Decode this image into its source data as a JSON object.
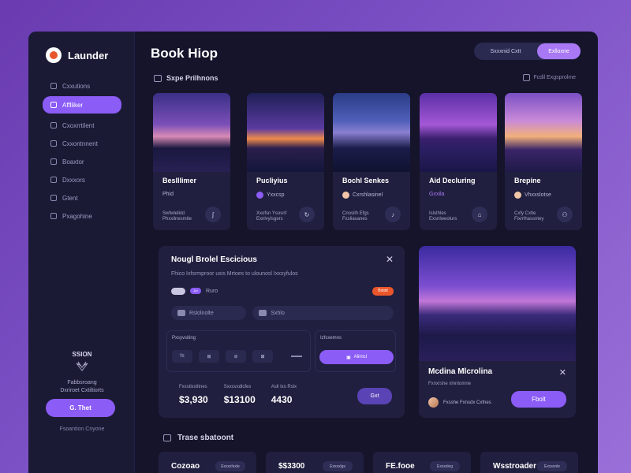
{
  "sidebar": {
    "logo": "Launder",
    "nav": [
      {
        "label": "Cxxutions",
        "icon": "home-icon"
      },
      {
        "label": "Afflliker",
        "icon": "user-icon",
        "active": true
      },
      {
        "label": "Cxoxrrtilent",
        "icon": "calendar-icon"
      },
      {
        "label": "Cxxontnnent",
        "icon": "folder-icon"
      },
      {
        "label": "Boaxtor",
        "icon": "box-icon"
      },
      {
        "label": "Dxxxors",
        "icon": "document-icon"
      },
      {
        "label": "Gtent",
        "icon": "chat-icon"
      },
      {
        "label": "Pxagohine",
        "icon": "settings-icon"
      }
    ],
    "promo_title": "SSION",
    "promo_lines": [
      "Fabbsroang",
      "Dxriroet Cxtiltiorts"
    ],
    "upgrade_label": "G. Thet",
    "footer": "Fsoantion Cnyone"
  },
  "header": {
    "title": "Book Hiop",
    "segment_left": "Sxxxnid Cxtt",
    "segment_right": "Exlloxne"
  },
  "section": {
    "title": "Sxpe Prilhnons",
    "right_label": "Fcdil Exgsprolme"
  },
  "cards": [
    {
      "name": "Beslllimer",
      "tag": "Phid",
      "meta1": "Swfwlelkld",
      "meta2": "Phxxilnesmite",
      "action": "∫",
      "colors": {
        "dot": "#8b5cf6"
      }
    },
    {
      "name": "Pucliyius",
      "tag": "Yxxcsp",
      "meta1": "Xxofsn Ysosnf",
      "meta2": "Exnlvylsgers",
      "action": "↻",
      "colors": {
        "dot": "#8b5cf6"
      }
    },
    {
      "name": "Bochl Senkes",
      "tag": "Cxrshlasinel",
      "meta1": "Cnosilh Efgs",
      "meta2": "Fxsliasanes",
      "action": "♪",
      "colors": {
        "dot": "#f1c6a8"
      }
    },
    {
      "name": "Aid Decluring",
      "tag": "Gxxila",
      "meta1": "Islsthles",
      "meta2": "Exsnlweolurs",
      "action": "⌂",
      "colors": {
        "dot": "#8b5cf6"
      }
    },
    {
      "name": "Brepine",
      "tag": "Vhxxslotse",
      "meta1": "Cxfy Cxtle",
      "meta2": "Fixrrlhassntey",
      "action": "⚇",
      "colors": {
        "dot": "#f1c6a8"
      }
    }
  ],
  "panel": {
    "title": "Nougl Brolel Escicious",
    "subtitle": "Fhico Ixfsrmproor uxis Mrtoes to ulounosl Ixxsyfulos",
    "toggle_pill": "Jur",
    "toggle_label": "Ruro",
    "badge": "Bxtoit",
    "input1": "Rslolnolte",
    "input2": "Sxhlo",
    "box_left_title": "Pxsyvsiting",
    "box_left_icons": [
      "f≡",
      "⊞",
      "⊘",
      "⊠"
    ],
    "box_right_title": "Izfsxemns",
    "box_right_button": "Alirncl",
    "stats": [
      {
        "label": "Fxxstlxxlitnes",
        "value": "$3,930"
      },
      {
        "label": "Sxxcvxdlcfes",
        "value": "$13100"
      },
      {
        "label": "Asll Ixs Rslx",
        "value": "4430"
      }
    ],
    "go_button": "Gxt"
  },
  "feature": {
    "title": "Mcdina Mlcrolina",
    "subtitle": "Fxnxrshe xlnntomne",
    "user": "Fxsshe Fxnsdx Cxfnes",
    "button": "Fbolt"
  },
  "bottom": {
    "title": "Trase sbatoont",
    "items": [
      {
        "value": "Cozoao",
        "pill": "Exxsxlnxle"
      },
      {
        "value": "$$3300",
        "pill": "Exxsxlgs"
      },
      {
        "value": "FE.fooe",
        "pill": "Exxsxleg"
      },
      {
        "value": "Wsstroader",
        "pill": "Exxsxnle"
      }
    ]
  }
}
